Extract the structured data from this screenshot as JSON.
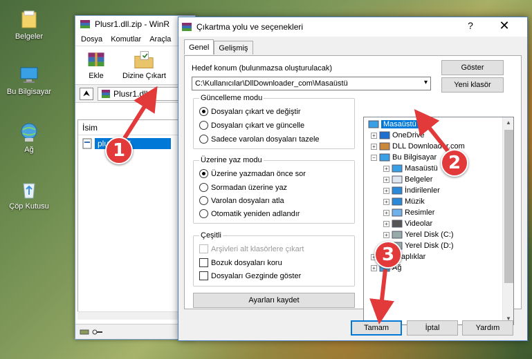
{
  "desktop": {
    "icons": [
      {
        "label": "Belgeler",
        "icon": "folder-icon"
      },
      {
        "label": "Bu Bilgisayar",
        "icon": "computer-icon"
      },
      {
        "label": "Ağ",
        "icon": "network-icon"
      },
      {
        "label": "Çöp Kutusu",
        "icon": "recycle-bin-icon"
      }
    ]
  },
  "winrar": {
    "title": "Plusr1.dll.zip - WinR",
    "menu": [
      "Dosya",
      "Komutlar",
      "Araçla"
    ],
    "toolbar": {
      "extract_label": "Ekle",
      "extract_to_label": "Dizine Çıkart"
    },
    "path": "Plusr1.dll.z",
    "column_name": "İsim",
    "file": "plusr1.dll"
  },
  "dialog": {
    "title": "Çıkartma yolu ve seçenekleri",
    "help": "?",
    "close": "✕",
    "tabs": [
      "Genel",
      "Gelişmiş"
    ],
    "dest_label": "Hedef konum (bulunmazsa oluşturulacak)",
    "dest_value": "C:\\Kullanıcılar\\DllDownloader_com\\Masaüstü",
    "show_button": "Göster",
    "new_folder_button": "Yeni klasör",
    "update_group": {
      "title": "Güncelleme modu",
      "options": [
        "Dosyaları çıkart ve değiştir",
        "Dosyaları çıkart ve güncelle",
        "Sadece varolan dosyaları tazele"
      ],
      "selected": 0
    },
    "overwrite_group": {
      "title": "Üzerine yaz modu",
      "options": [
        "Üzerine yazmadan önce sor",
        "Sormadan üzerine yaz",
        "Varolan dosyaları atla",
        "Otomatik yeniden adlandır"
      ],
      "selected": 0
    },
    "misc_group": {
      "title": "Çeşitli",
      "options": [
        "Arşivleri alt klasörlere çıkart",
        "Bozuk dosyaları koru",
        "Dosyaları Gezginde göster"
      ]
    },
    "save_settings": "Ayarları kaydet",
    "tree": [
      {
        "label": "Masaüstü",
        "depth": 0,
        "pm": "",
        "icon": "desktop-icon",
        "selected": true
      },
      {
        "label": "OneDrive",
        "depth": 1,
        "pm": "+",
        "icon": "onedrive-icon"
      },
      {
        "label": "DLL Downloader.com",
        "depth": 1,
        "pm": "+",
        "icon": "user-icon"
      },
      {
        "label": "Bu Bilgisayar",
        "depth": 1,
        "pm": "−",
        "icon": "computer-icon"
      },
      {
        "label": "Masaüstü",
        "depth": 2,
        "pm": "+",
        "icon": "desktop-icon"
      },
      {
        "label": "Belgeler",
        "depth": 2,
        "pm": "+",
        "icon": "documents-icon"
      },
      {
        "label": "İndirilenler",
        "depth": 2,
        "pm": "+",
        "icon": "download-icon"
      },
      {
        "label": "Müzik",
        "depth": 2,
        "pm": "+",
        "icon": "music-icon"
      },
      {
        "label": "Resimler",
        "depth": 2,
        "pm": "+",
        "icon": "pictures-icon"
      },
      {
        "label": "Videolar",
        "depth": 2,
        "pm": "+",
        "icon": "videos-icon"
      },
      {
        "label": "Yerel Disk (C:)",
        "depth": 2,
        "pm": "+",
        "icon": "drive-icon"
      },
      {
        "label": "Yerel Disk (D:)",
        "depth": 2,
        "pm": "+",
        "icon": "drive-icon"
      },
      {
        "label": "Kitaplıklar",
        "depth": 1,
        "pm": "+",
        "icon": "libraries-icon"
      },
      {
        "label": "Ağ",
        "depth": 1,
        "pm": "+",
        "icon": "network-icon"
      }
    ],
    "buttons": {
      "ok": "Tamam",
      "cancel": "İptal",
      "help": "Yardım"
    }
  },
  "annotations": [
    "1",
    "2",
    "3"
  ],
  "colors": {
    "accent": "#0078d7",
    "marker": "#e23a3a"
  }
}
